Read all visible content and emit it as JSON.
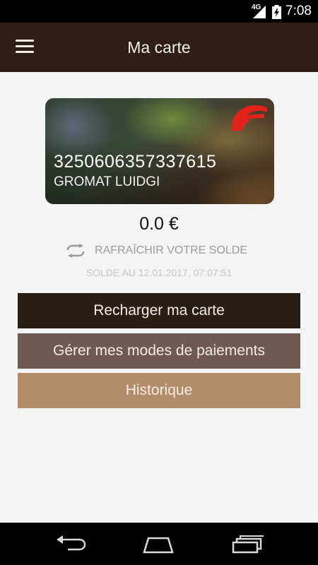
{
  "status_bar": {
    "network": "4G",
    "time": "7:08"
  },
  "app_bar": {
    "title": "Ma carte",
    "menu_icon": "hamburger-menu-icon"
  },
  "card": {
    "number": "3250606357337615",
    "holder": "GROMAT LUIDGI",
    "logo_icon": "brand-logo-icon",
    "accent_color": "#e2231a"
  },
  "balance": {
    "amount": "0.0 €"
  },
  "refresh": {
    "label": "RAFRAÎCHIR VOTRE SOLDE",
    "icon": "refresh-icon"
  },
  "balance_date": "SOLDE AU 12.01.2017, 07:07:51",
  "actions": {
    "recharge": "Recharger ma carte",
    "payment_methods": "Gérer mes modes de paiements",
    "history": "Historique"
  },
  "colors": {
    "header_bg": "#2d1f15",
    "btn_recharge": "#2b1e14",
    "btn_payment": "#6d5a50",
    "btn_history": "#b38c6c"
  },
  "nav_bar": {
    "back_icon": "back-icon",
    "home_icon": "home-icon",
    "recents_icon": "recents-icon"
  }
}
